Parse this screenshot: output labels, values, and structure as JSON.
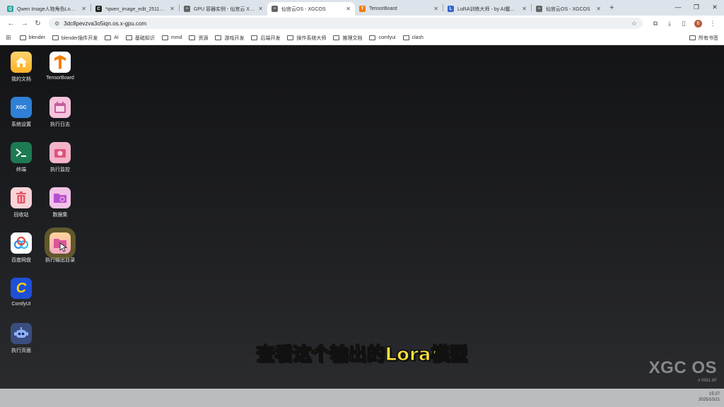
{
  "tabs": [
    {
      "label": "Qwen Image人物角色LoRA训…",
      "color": "#26a6a0",
      "glyph": "Q",
      "active": false
    },
    {
      "label": "*qwen_image_edit_2511电商…",
      "color": "#222222",
      "glyph": "C",
      "active": false
    },
    {
      "label": "GPU 容器实例 - 仙宫云 Xiang…",
      "color": "#555555",
      "glyph": "~",
      "active": false
    },
    {
      "label": "仙宫云OS - XGCOS",
      "color": "#555555",
      "glyph": "~",
      "active": true
    },
    {
      "label": "TensorBoard",
      "color": "#f57c00",
      "glyph": "T",
      "active": false
    },
    {
      "label": "LoRA训练大师 - by AI魔法手",
      "color": "#3366cc",
      "glyph": "L",
      "active": false
    },
    {
      "label": "仙宫云OS - XGCOS",
      "color": "#555555",
      "glyph": "~",
      "active": false
    }
  ],
  "browser": {
    "url": "3dc8pevzva3o5iqn.os.x-gpu.com",
    "profile_initial": "6"
  },
  "bookmarks": [
    "blender",
    "blender插件开发",
    "AI",
    "基础知识",
    "mmd",
    "资源",
    "游戏开发",
    "后端开发",
    "操作系统大师",
    "推理文档",
    "comfyui",
    "clash"
  ],
  "bookmarks_right": "所有书签",
  "desktop_icons": [
    {
      "label": "我的文档",
      "tile": "t-home",
      "icon": "home"
    },
    {
      "label": "TensorBoard",
      "tile": "t-tb",
      "icon": "tensorboard"
    },
    {
      "label": "系统设置",
      "tile": "t-xgc",
      "icon": "xgc",
      "tile_text": "XGC"
    },
    {
      "label": "执行日志",
      "tile": "t-cal",
      "icon": "calendar"
    },
    {
      "label": "终端",
      "tile": "t-term",
      "icon": "terminal"
    },
    {
      "label": "执行监控",
      "tile": "t-cam",
      "icon": "camera"
    },
    {
      "label": "回收站",
      "tile": "t-trash",
      "icon": "trash"
    },
    {
      "label": "数据集",
      "tile": "t-data",
      "icon": "folder-dataset"
    },
    {
      "label": "百度网盘",
      "tile": "t-baidu",
      "icon": "baidu-cloud"
    },
    {
      "label": "执行输出目录",
      "tile": "t-out",
      "icon": "folder-output"
    },
    {
      "label": "ComfyUI",
      "tile": "t-comfy",
      "icon": "comfyui",
      "tile_text": "C"
    },
    {
      "label": "执行页面",
      "tile": "t-page",
      "icon": "robot"
    }
  ],
  "caption": "查看这个输出的Lora模型",
  "brand": {
    "wordmark": "XGC OS",
    "build": "# 0951.6F"
  },
  "clock": {
    "time": "15:27",
    "date": "2025/10/21"
  }
}
